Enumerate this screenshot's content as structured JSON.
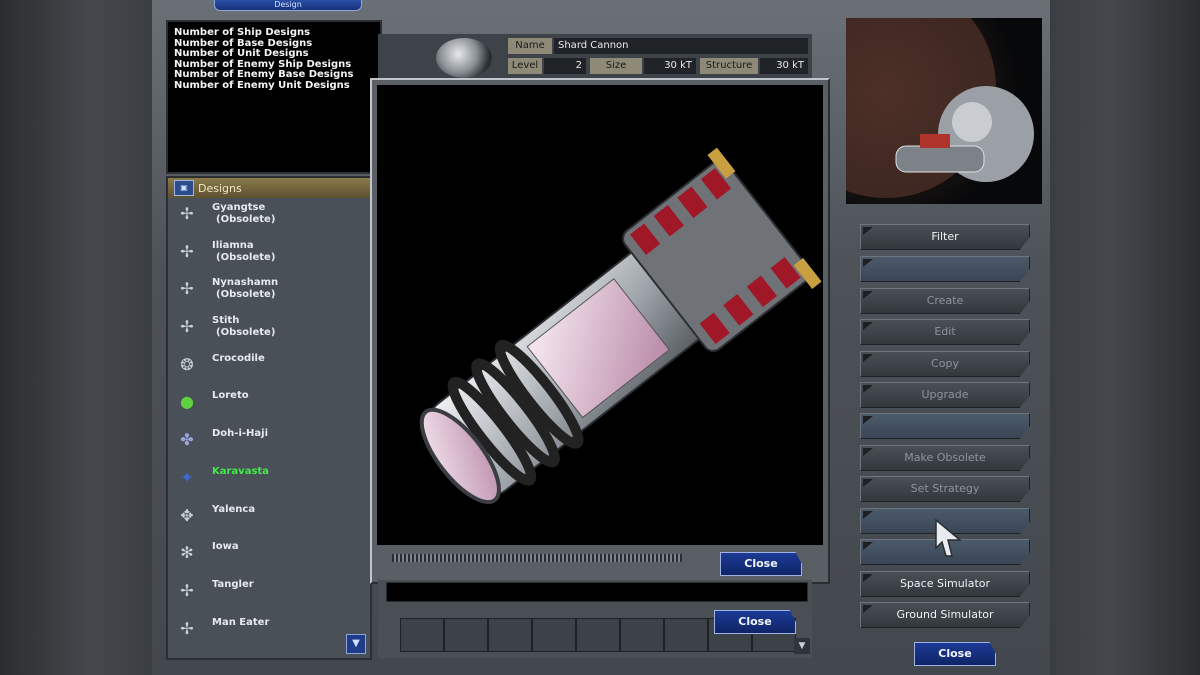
{
  "window": {
    "title": "Design"
  },
  "stats": [
    "Number of Ship Designs",
    "Number of Base Designs",
    "Number of Unit Designs",
    "Number of Enemy Ship Designs",
    "Number of Enemy Base Designs",
    "Number of Enemy Unit Designs"
  ],
  "designs": {
    "header": "Designs",
    "items": [
      {
        "name": "Gyangtse",
        "status": "(Obsolete)"
      },
      {
        "name": "Iliamna",
        "status": "(Obsolete)"
      },
      {
        "name": "Nynashamn",
        "status": "(Obsolete)"
      },
      {
        "name": "Stith",
        "status": "(Obsolete)"
      },
      {
        "name": "Crocodile",
        "status": ""
      },
      {
        "name": "Loreto",
        "status": ""
      },
      {
        "name": "Doh-i-Haji",
        "status": ""
      },
      {
        "name": "Karavasta",
        "status": "",
        "selected": true
      },
      {
        "name": "Yalenca",
        "status": ""
      },
      {
        "name": "Iowa",
        "status": ""
      },
      {
        "name": "Tangler",
        "status": ""
      },
      {
        "name": "Man Eater",
        "status": ""
      }
    ]
  },
  "detail": {
    "name_label": "Name",
    "name_value": "Shard Cannon",
    "level_label": "Level",
    "level_value": "2",
    "size_label": "Size",
    "size_value": "30 kT",
    "structure_label": "Structure",
    "structure_value": "30 kT"
  },
  "viewer": {
    "close_label": "Close"
  },
  "main": {
    "close_label": "Close"
  },
  "commands": [
    {
      "label": "Filter",
      "enabled": true
    },
    {
      "label": "",
      "enabled": false
    },
    {
      "label": "Create",
      "enabled": false
    },
    {
      "label": "Edit",
      "enabled": false
    },
    {
      "label": "Copy",
      "enabled": false
    },
    {
      "label": "Upgrade",
      "enabled": false
    },
    {
      "label": "",
      "enabled": false
    },
    {
      "label": "Make Obsolete",
      "enabled": false
    },
    {
      "label": "Set Strategy",
      "enabled": false
    },
    {
      "label": "",
      "enabled": false
    },
    {
      "label": "",
      "enabled": false
    },
    {
      "label": "Space Simulator",
      "enabled": true
    },
    {
      "label": "Ground Simulator",
      "enabled": true
    }
  ],
  "right_close_label": "Close",
  "colors": {
    "selected": "#44e84a",
    "button_blue": "#1c3b96"
  }
}
